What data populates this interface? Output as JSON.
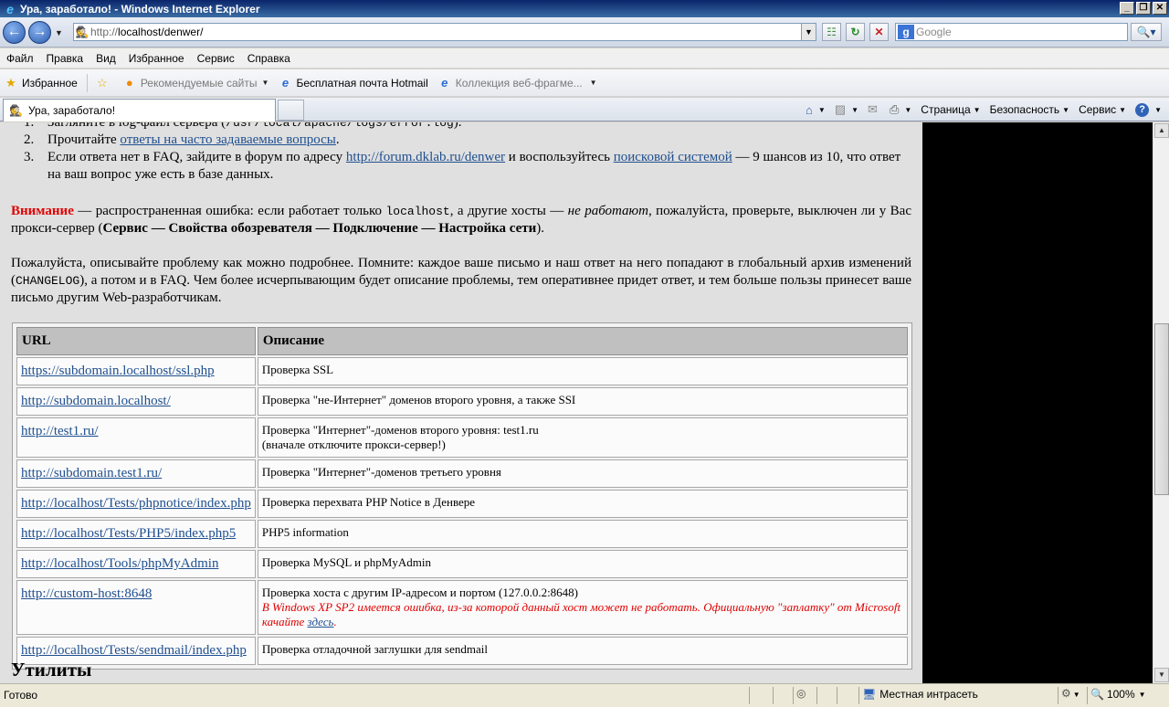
{
  "window": {
    "title": "Ура, заработало! - Windows Internet Explorer",
    "minimize": "_",
    "maximize": "❐",
    "close": "✕"
  },
  "address": {
    "url_prefix": "http://",
    "url_host": "localhost/denwer/"
  },
  "search": {
    "placeholder": "Google"
  },
  "menu": [
    "Файл",
    "Правка",
    "Вид",
    "Избранное",
    "Сервис",
    "Справка"
  ],
  "favorites": {
    "main": "Избранное",
    "suggested": "Рекомендуемые сайты",
    "hotmail": "Бесплатная почта Hotmail",
    "gallery": "Коллекция веб-фрагме..."
  },
  "tab": {
    "title": "Ура, заработало!"
  },
  "command_bar": {
    "page": "Страница",
    "safety": "Безопасность",
    "tools": "Сервис"
  },
  "content": {
    "list": [
      {
        "num": "1.",
        "pre": "Загляните в log-файл сервера (",
        "code": "/usr/local/apache/logs/error.log",
        "post": ")."
      },
      {
        "num": "2.",
        "pre": "Прочитайте ",
        "link": "ответы на часто задаваемые вопросы",
        "post": "."
      },
      {
        "num": "3.",
        "pre": "Если ответа нет в FAQ, зайдите в форум по адресу ",
        "link1": "http://forum.dklab.ru/denwer",
        "mid": " и воспользуйтесь ",
        "link2": "поисковой системой",
        "post": " — 9 шансов из 10, что ответ на ваш вопрос уже есть в базе данных."
      }
    ],
    "warning": {
      "word": "Внимание",
      "t1": " — распространенная ошибка: если работает только ",
      "code": "localhost",
      "t2": ", а другие хосты — ",
      "em": "не работают",
      "t3": ", пожалуйста, проверьте, выключен ли у Вас прокси-сервер (",
      "bold": "Сервис — Свойства обозревателя — Подключение — Настройка сети",
      "t4": ")."
    },
    "describe": {
      "t1": "Пожалуйста, описывайте проблему как можно подробнее. Помните: каждое ваше письмо и наш ответ на него попадают в глобальный архив изменений (",
      "code": "CHANGELOG",
      "t2": "), а потом и в FAQ. Чем более исчерпывающим будет описание проблемы, тем оперативнее придет ответ, и тем больше пользы принесет ваше письмо другим Web-разработчикам."
    },
    "table": {
      "headers": [
        "URL",
        "Описание"
      ],
      "rows": [
        {
          "url": "https://subdomain.localhost/ssl.php",
          "desc": "Проверка SSL"
        },
        {
          "url": "http://subdomain.localhost/",
          "desc": "Проверка \"не-Интернет\" доменов второго уровня, а также SSI"
        },
        {
          "url": "http://test1.ru/",
          "desc": "Проверка \"Интернет\"-доменов второго уровня: test1.ru",
          "desc2": "(вначале отключите прокси-сервер!)"
        },
        {
          "url": "http://subdomain.test1.ru/",
          "desc": "Проверка \"Интернет\"-доменов третьего уровня"
        },
        {
          "url": "http://localhost/Tests/phpnotice/index.php",
          "desc": "Проверка перехвата PHP Notice в Денвере"
        },
        {
          "url": "http://localhost/Tests/PHP5/index.php5",
          "desc": "PHP5 information"
        },
        {
          "url": "http://localhost/Tools/phpMyAdmin",
          "desc": "Проверка MySQL и phpMyAdmin"
        },
        {
          "url": "http://custom-host:8648",
          "desc": "Проверка хоста с другим IP-адресом и портом (127.0.0.2:8648)",
          "note": "В Windows XP SP2 имеется ошибка, из-за которой данный хост может не работать. Официальную \"заплатку\" от Microsoft качайте ",
          "note_link": "здесь",
          "note_end": "."
        },
        {
          "url": "http://localhost/Tests/sendmail/index.php",
          "desc": "Проверка отладочной заглушки для sendmail"
        }
      ]
    },
    "utilities_heading": "Утилиты"
  },
  "status": {
    "text": "Готово",
    "zone": "Местная интрасеть",
    "zoom": "100%"
  }
}
